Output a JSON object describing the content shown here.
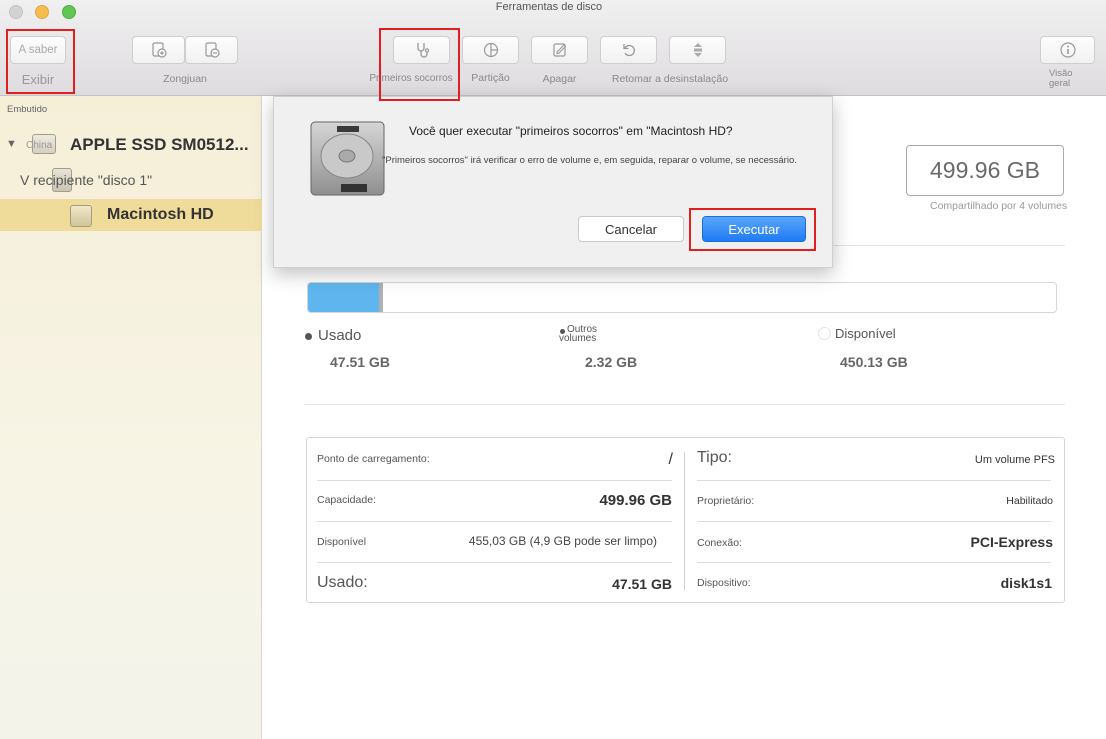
{
  "window": {
    "title": "Ferramentas de disco"
  },
  "toolbar": {
    "view_button_label": "A saber",
    "view_label": "Exibir",
    "volume_label": "Zongjuan",
    "first_aid_label": "Primeiros socorros",
    "partition_label": "Partição",
    "erase_label": "Apagar",
    "restore_label": "Retomar a desinstalação",
    "info_label": "Visão geral"
  },
  "sidebar": {
    "section": "Embutido",
    "disk_tag": "China",
    "disk_name": "APPLE SSD SM0512...",
    "container": "V recipiente \"disco 1\"",
    "volume": "Macintosh HD"
  },
  "summary": {
    "capacity": "499.96 GB",
    "shared": "Compartilhado por 4 volumes"
  },
  "usage": {
    "used_label": "Usado",
    "used_value": "47.51 GB",
    "used_fraction": 0.095,
    "other_label": "Outros volumes",
    "other_value": "2.32 GB",
    "other_fraction": 0.005,
    "available_label": "Disponível",
    "available_value": "450.13 GB",
    "colors": {
      "used": "#5fb6ee",
      "other": "#b0b0b0",
      "available": "#ffffff"
    }
  },
  "info": {
    "mount_label": "Ponto de carregamento:",
    "mount_value": "/",
    "capacity_label": "Capacidade:",
    "capacity_value": "499.96 GB",
    "available_label": "Disponível",
    "available_value": "455,03 GB (4,9 GB pode ser limpo)",
    "used_label": "Usado:",
    "used_value": "47.51 GB",
    "type_label": "Tipo:",
    "type_value": "Um volume PFS",
    "owner_label": "Proprietário:",
    "owner_value": "Habilitado",
    "connection_label": "Conexão:",
    "connection_value": "PCI-Express",
    "device_label": "Dispositivo:",
    "device_value": "disk1s1"
  },
  "dialog": {
    "title": "Você quer executar \"primeiros socorros\" em \"Macintosh HD?",
    "message": "\"Primeiros socorros\" irá verificar o erro de volume e, em seguida, reparar o volume, se necessário.",
    "cancel_label": "Cancelar",
    "execute_label": "Executar",
    "accent_color": "#1f7bf3"
  }
}
